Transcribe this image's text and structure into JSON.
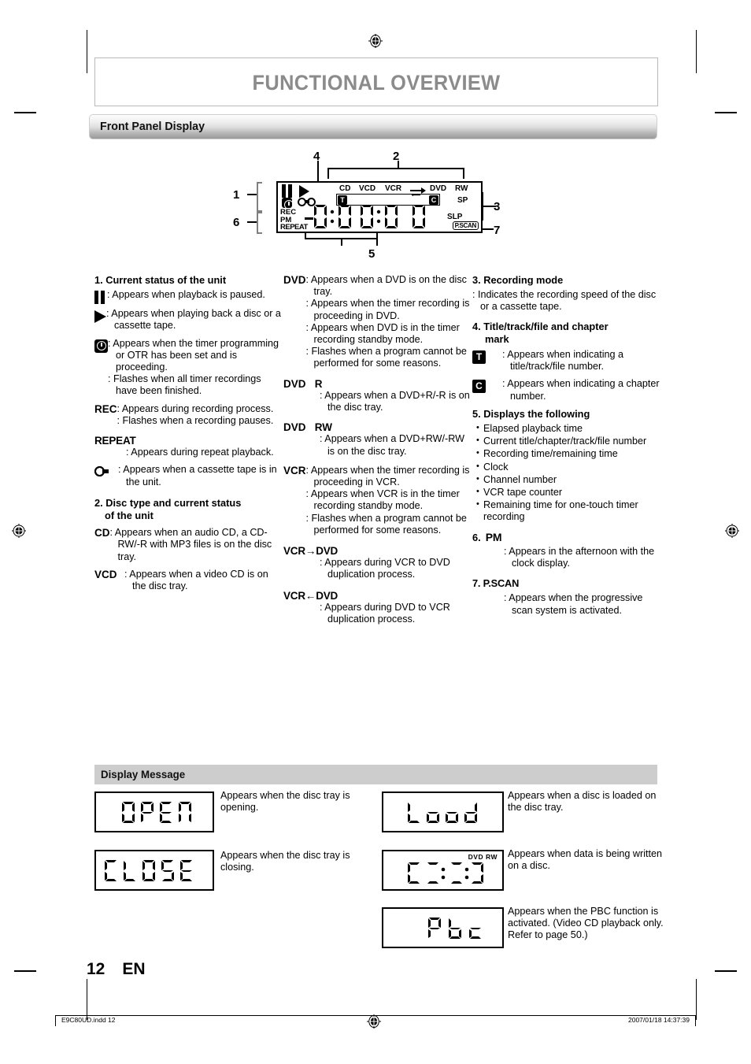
{
  "page": {
    "title": "FUNCTIONAL OVERVIEW",
    "number": "12",
    "lang": "EN",
    "footer_left": "E9C80UD.indd   12",
    "footer_right": "2007/01/18   14:37:39"
  },
  "sections": {
    "front_panel_display": "Front Panel Display",
    "display_message": "Display Message"
  },
  "lcd_diagram": {
    "callouts": [
      "1",
      "2",
      "3",
      "4",
      "5",
      "6",
      "7"
    ],
    "top_indicators": [
      "CD",
      "VCD",
      "VCR",
      "arrow-icon",
      "DVD",
      "RW"
    ],
    "left_indicators": [
      "pause-icon",
      "play-icon",
      "clock-icon",
      "cassette-icon",
      "REC",
      "PM",
      "REPEAT"
    ],
    "mid_indicators": [
      "T",
      "C"
    ],
    "right_indicators": [
      "SP",
      "SLP",
      "P.SCAN"
    ],
    "digits": "88:88:88"
  },
  "col1": {
    "heading": "1. Current status of the unit",
    "items": [
      {
        "icon": "pause-icon",
        "lines": [
          ": Appears when playback is paused."
        ]
      },
      {
        "icon": "play-icon",
        "lines": [
          ": Appears when playing back a disc or a cassette tape."
        ]
      },
      {
        "icon": "clock-icon",
        "lines": [
          ": Appears when the timer programming or OTR has been set and is proceeding.",
          ": Flashes when all timer recordings have been finished."
        ]
      },
      {
        "icon": "REC",
        "lines": [
          ": Appears during recording process.",
          ": Flashes when a recording pauses."
        ]
      },
      {
        "icon": "REPEAT",
        "lines": [
          ": Appears during repeat playback."
        ]
      },
      {
        "icon": "cassette-icon",
        "lines": [
          ": Appears when a cassette tape is in the unit."
        ]
      }
    ],
    "heading2_line1": "2. Disc type and current status",
    "heading2_line2": "of the unit",
    "items2": [
      {
        "icon": "CD",
        "lines": [
          ": Appears when an audio CD, a CD-RW/-R with MP3 files is on the disc tray."
        ]
      },
      {
        "icon": "VCD",
        "lines": [
          ": Appears when a video CD is on the disc tray."
        ]
      }
    ]
  },
  "col2": {
    "items": [
      {
        "icon": "DVD",
        "lines": [
          ": Appears when a DVD is on the disc tray.",
          ": Appears when the timer recording is proceeding in DVD.",
          ": Appears when DVD is in the timer recording standby mode.",
          ": Flashes when a program cannot be performed for some reasons."
        ]
      },
      {
        "icon": "DVD   R",
        "lines": [
          ": Appears when a DVD+R/-R is on the disc tray."
        ]
      },
      {
        "icon": "DVD   RW",
        "lines": [
          ": Appears when a DVD+RW/-RW is on the disc tray."
        ]
      },
      {
        "icon": "VCR",
        "lines": [
          ": Appears when the timer recording is proceeding in VCR.",
          ": Appears when VCR is in the timer recording standby mode.",
          ": Flashes when a program cannot be performed for some reasons."
        ]
      },
      {
        "icon": "VCR→DVD",
        "lines": [
          ": Appears during VCR to DVD duplication process."
        ]
      },
      {
        "icon": "VCR←DVD",
        "lines": [
          ": Appears during DVD to VCR duplication process."
        ]
      }
    ]
  },
  "col3": {
    "heading3": "3. Recording mode",
    "rec_mode_desc": ": Indicates the recording speed of the disc or a cassette tape.",
    "heading4_line1": "4. Title/track/file and chapter",
    "heading4_line2": "mark",
    "items4": [
      {
        "icon": "T",
        "lines": [
          ": Appears when indicating a title/track/file number."
        ]
      },
      {
        "icon": "C",
        "lines": [
          ": Appears when indicating a chapter number."
        ]
      }
    ],
    "heading5": "5. Displays the following",
    "bullets5": [
      "Elapsed playback time",
      "Current title/chapter/track/file number",
      "Recording time/remaining time",
      "Clock",
      "Channel number",
      "VCR tape counter",
      "Remaining time for one-touch timer recording"
    ],
    "heading6": "6.",
    "heading6_key": "PM",
    "desc6": ": Appears in the afternoon with the clock display.",
    "heading7": "7. P.SCAN",
    "desc7": ": Appears when the progressive scan system is activated."
  },
  "display_messages": [
    {
      "screen_text": "OPEN",
      "badge": "",
      "description": "Appears when the disc tray is opening."
    },
    {
      "screen_text": "CLOSE",
      "badge": "",
      "description": "Appears when the disc tray is closing."
    },
    {
      "screen_text": "Load",
      "badge": "",
      "description": "Appears when a disc is loaded on the disc tray."
    },
    {
      "screen_text": "C:::]",
      "badge": "DVD  RW",
      "description": "Appears when data is being written on a disc."
    },
    {
      "screen_text": "Pbc",
      "badge": "",
      "description": "Appears when the PBC function is activated. (Video CD playback only. Refer to page 50.)"
    }
  ]
}
